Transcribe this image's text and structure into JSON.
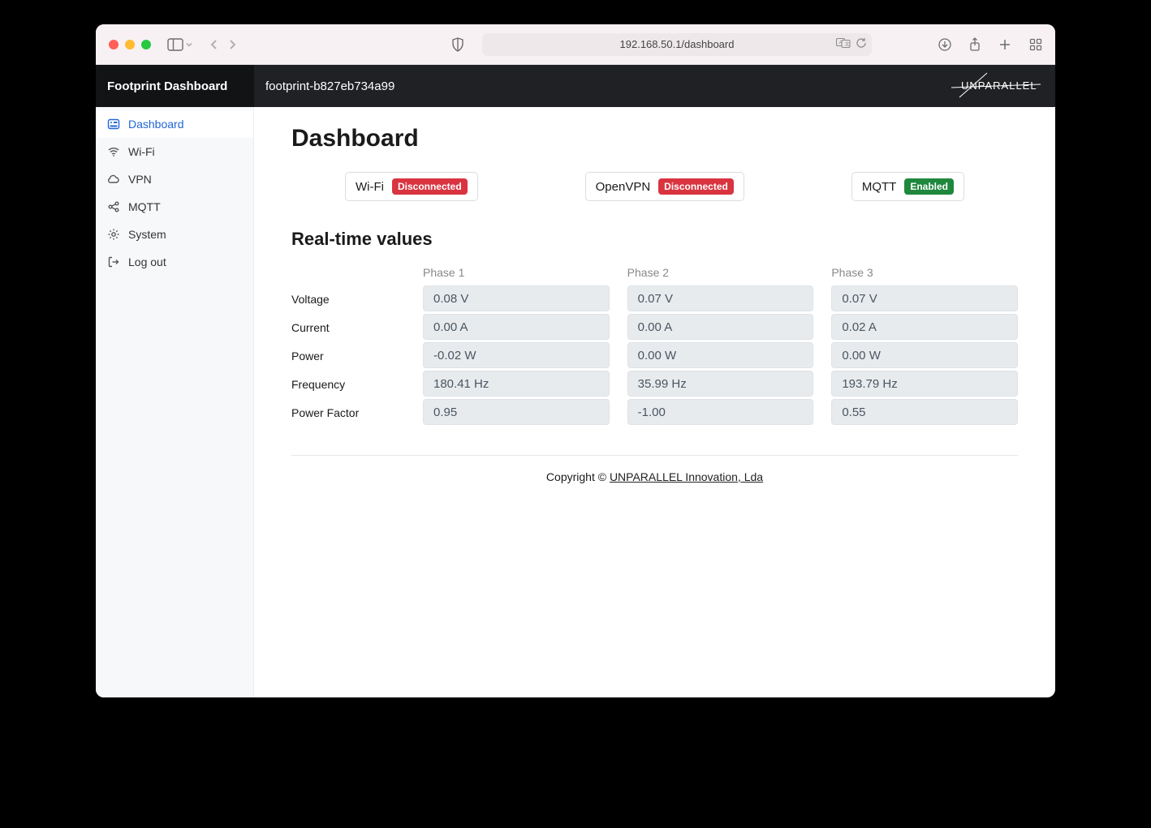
{
  "browser": {
    "url": "192.168.50.1/dashboard"
  },
  "header": {
    "brand": "Footprint Dashboard",
    "host": "footprint-b827eb734a99",
    "logo_text": "UNPARALLEL"
  },
  "sidebar": {
    "items": [
      {
        "label": "Dashboard",
        "icon": "gauge-icon",
        "active": true
      },
      {
        "label": "Wi-Fi",
        "icon": "wifi-icon",
        "active": false
      },
      {
        "label": "VPN",
        "icon": "cloud-icon",
        "active": false
      },
      {
        "label": "MQTT",
        "icon": "share-icon",
        "active": false
      },
      {
        "label": "System",
        "icon": "gear-icon",
        "active": false
      },
      {
        "label": "Log out",
        "icon": "logout-icon",
        "active": false
      }
    ]
  },
  "page": {
    "title": "Dashboard",
    "section_title": "Real-time values"
  },
  "status": [
    {
      "name": "Wi-Fi",
      "state": "Disconnected",
      "kind": "bad"
    },
    {
      "name": "OpenVPN",
      "state": "Disconnected",
      "kind": "bad"
    },
    {
      "name": "MQTT",
      "state": "Enabled",
      "kind": "ok"
    }
  ],
  "table": {
    "columns": [
      "Phase 1",
      "Phase 2",
      "Phase 3"
    ],
    "rows": [
      {
        "label": "Voltage",
        "values": [
          "0.08 V",
          "0.07 V",
          "0.07 V"
        ]
      },
      {
        "label": "Current",
        "values": [
          "0.00 A",
          "0.00 A",
          "0.02 A"
        ]
      },
      {
        "label": "Power",
        "values": [
          "-0.02 W",
          "0.00 W",
          "0.00 W"
        ]
      },
      {
        "label": "Frequency",
        "values": [
          "180.41 Hz",
          "35.99 Hz",
          "193.79 Hz"
        ]
      },
      {
        "label": "Power Factor",
        "values": [
          "0.95",
          "-1.00",
          "0.55"
        ]
      }
    ]
  },
  "footer": {
    "prefix": "Copyright © ",
    "link_text": "UNPARALLEL Innovation, Lda"
  }
}
